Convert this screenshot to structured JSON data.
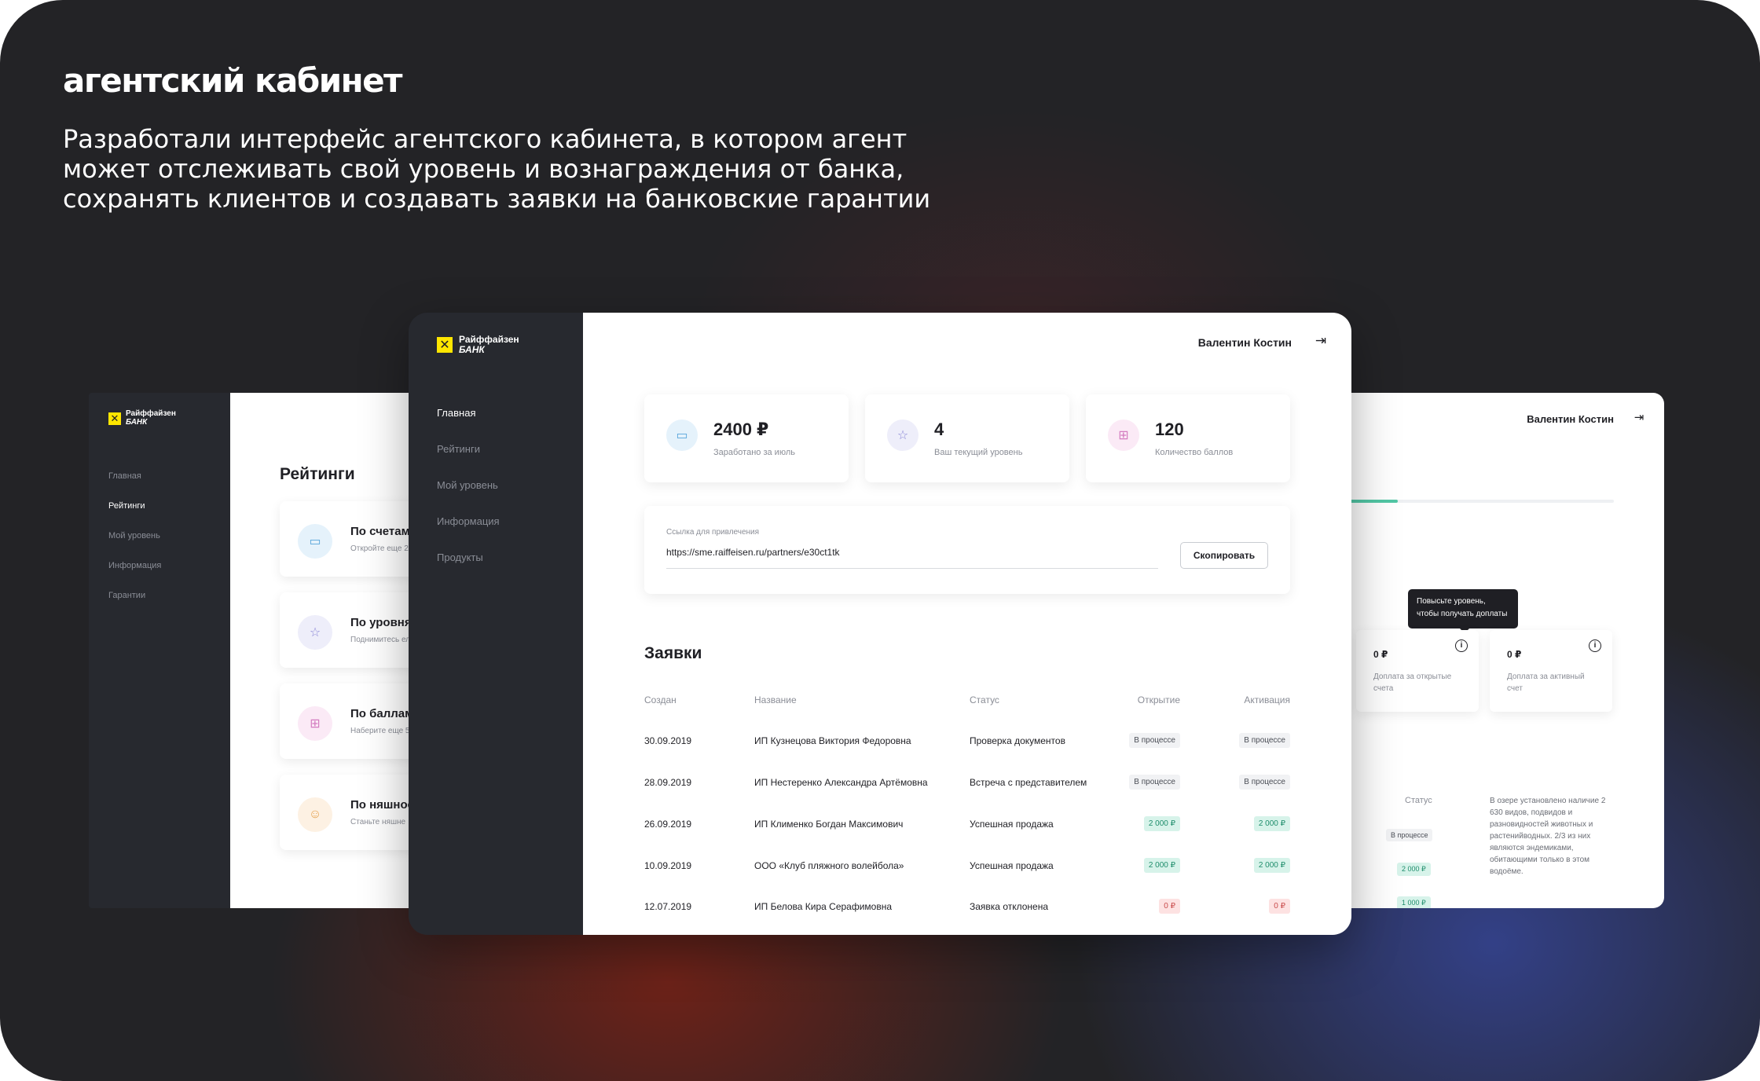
{
  "headline": "агентский кабинет",
  "lead": "Разработали интерфейс агентского кабинета, в котором агент может отслеживать свой уровень и вознаграждения от банка, сохранять клиентов и создавать заявки на банковские гарантии",
  "brand": {
    "name_line1": "Райффайзен",
    "name_line2": "БАНК",
    "logo_mark": "✕",
    "accent": "#fee600"
  },
  "user": {
    "name": "Валентин Костин"
  },
  "left_window": {
    "nav": [
      "Главная",
      "Рейтинги",
      "Мой уровень",
      "Информация",
      "Гарантии"
    ],
    "active_index": 1,
    "title": "Рейтинги",
    "cards": [
      {
        "title": "По счетам",
        "subtitle": "Откройте еще 2",
        "icon": "card-icon",
        "color": "#e5f2fb"
      },
      {
        "title": "По уровням",
        "subtitle": "Поднимитесь ел",
        "icon": "star-icon",
        "color": "#eeeefa"
      },
      {
        "title": "По баллам",
        "subtitle": "Наберите еще 5",
        "icon": "gift-icon",
        "color": "#fbeaf6"
      },
      {
        "title": "По няшности",
        "subtitle": "Станьте няшне",
        "icon": "smile-icon",
        "color": "#fdf1e3"
      }
    ]
  },
  "main_window": {
    "nav": [
      "Главная",
      "Рейтинги",
      "Мой уровень",
      "Информация",
      "Продукты"
    ],
    "active_index": 0,
    "stats": [
      {
        "value": "2400 ₽",
        "caption": "Заработано за июль",
        "icon": "card-icon",
        "color": "#e5f2fb"
      },
      {
        "value": "4",
        "caption": "Ваш текущий уровень",
        "icon": "star-icon",
        "color": "#eeeefa"
      },
      {
        "value": "120",
        "caption": "Количество баллов",
        "icon": "gift-icon",
        "color": "#fbeaf6"
      }
    ],
    "referral": {
      "label": "Ссылка для привлечения",
      "url": "https://sme.raiffeisen.ru/partners/e30ct1tk",
      "copy_label": "Скопировать"
    },
    "requests": {
      "title": "Заявки",
      "columns": [
        "Создан",
        "Название",
        "Статус",
        "Открытие",
        "Активация"
      ],
      "rows": [
        {
          "date": "30.09.2019",
          "name": "ИП Кузнецова Виктория Федоровна",
          "status": "Проверка документов",
          "opening": "В процессе",
          "activation": "В процессе",
          "kind": "process"
        },
        {
          "date": "28.09.2019",
          "name": "ИП Нестеренко Александра Артёмовна",
          "status": "Встреча с представителем",
          "opening": "В процессе",
          "activation": "В процессе",
          "kind": "process"
        },
        {
          "date": "26.09.2019",
          "name": "ИП Клименко Богдан Максимович",
          "status": "Успешная продажа",
          "opening": "2 000 ₽",
          "activation": "2 000 ₽",
          "kind": "ok"
        },
        {
          "date": "10.09.2019",
          "name": "ООО «Клуб пляжного волейбола»",
          "status": "Успешная продажа",
          "opening": "2 000 ₽",
          "activation": "2 000 ₽",
          "kind": "ok"
        },
        {
          "date": "12.07.2019",
          "name": "ИП Белова Кира Серафимовна",
          "status": "Заявка отклонена",
          "opening": "0 ₽",
          "activation": "0 ₽",
          "kind": "no"
        }
      ]
    }
  },
  "right_window": {
    "level_progress": 0.2,
    "tooltip": "Повысьте уровень, чтобы получать доплаты",
    "bonuses": [
      {
        "amount": "0 ₽",
        "label": "Доплата за открытые счета"
      },
      {
        "amount": "0 ₽",
        "label": "Доплата за активный счет"
      }
    ],
    "status_header": "Статус",
    "statuses": [
      "В процессе",
      "2 000 ₽",
      "1 000 ₽"
    ],
    "note": "В озере установлено наличие 2 630 видов, подвидов и разновидностей животных и растенийводных. 2/3 из них являются эндемиками, обитающими только в этом водоёме."
  }
}
